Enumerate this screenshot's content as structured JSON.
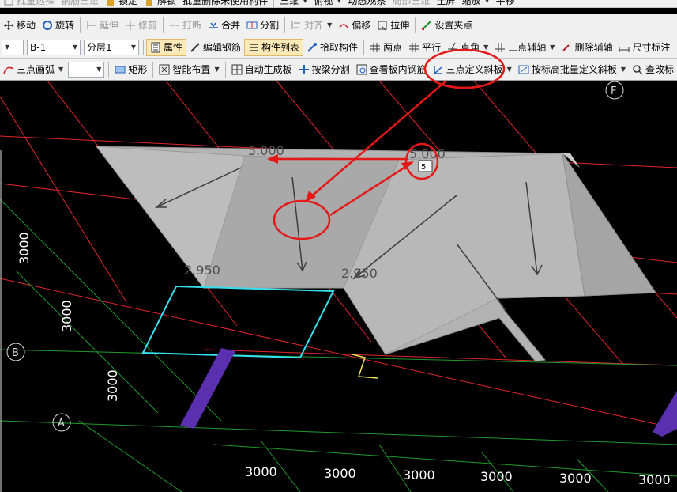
{
  "toolbar_top": {
    "items": [
      "批量选择",
      "钢筋三维",
      "锁定",
      "解锁",
      "批量删除未使用构件",
      "三维",
      "俯视",
      "动态观察",
      "局部三维",
      "全屏",
      "缩放",
      "平移"
    ]
  },
  "toolbar_edit": {
    "move": "移动",
    "rotate": "旋转",
    "extend": "延伸",
    "trim": "修剪",
    "break": "打断",
    "merge": "合并",
    "split": "分割",
    "align": "对齐",
    "offset": "偏移",
    "stretch": "拉伸",
    "set_grip": "设置夹点"
  },
  "toolbar_props": {
    "component_combo": "B-1",
    "floor_combo": "分层1",
    "properties": "属性",
    "edit_rebar": "编辑钢筋",
    "component_list": "构件列表",
    "pick_component": "拾取构件",
    "two_points": "两点",
    "parallel": "平行",
    "point_angle": "点角",
    "three_point_aux": "三点辅轴",
    "delete_aux": "删除辅轴",
    "dimension": "尺寸标注"
  },
  "toolbar_draw": {
    "three_point_arc": "三点画弧",
    "rectangle": "矩形",
    "smart_layout": "智能布置",
    "auto_slab": "自动生成板",
    "split_by_beam": "按梁分割",
    "view_slab_rebar": "查看板内钢筋",
    "three_point_slope": "三点定义斜板",
    "batch_slope_by_elev": "按标高批量定义斜板",
    "check_modify": "查改标"
  },
  "viewport": {
    "axis_labels": [
      "F",
      "B",
      "A"
    ],
    "grid_dims_horizontal": [
      "3000",
      "3000",
      "3000",
      "3000",
      "3000",
      "3000"
    ],
    "grid_dims_vertical": [
      "3000",
      "3000",
      "3000"
    ],
    "elevation_labels": [
      "5.000",
      "5.000",
      "2.950",
      "2.950"
    ],
    "input_value": "5"
  },
  "colors": {
    "toolbar_bg": "#f0f0f0",
    "canvas_bg": "#000000",
    "grid_red": "#e0262a",
    "grid_green": "#1f9a2f",
    "slab_gray": "#b4b4b4",
    "column_purple": "#5a2fb0",
    "selection_cyan": "#35e0f0",
    "annotation_red": "#e51818"
  }
}
